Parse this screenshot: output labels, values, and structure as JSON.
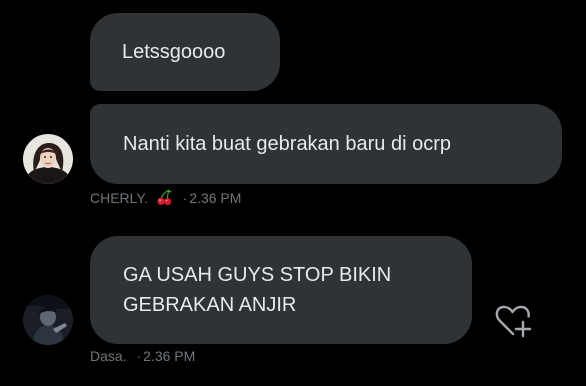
{
  "messages": [
    {
      "text": "Letssgoooo"
    },
    {
      "text": "Nanti kita buat gebrakan baru di ocrp",
      "author": "CHERLY.",
      "author_emoji": "cherry",
      "time": "2.36 PM",
      "sep": "·"
    },
    {
      "lines": [
        "GA USAH GUYS STOP BIKIN",
        "GEBRAKAN ANJIR"
      ],
      "author": "Dasa.",
      "time": "2.36 PM",
      "sep": "·"
    }
  ],
  "colors": {
    "background": "#000000",
    "bubble": "#2f3336",
    "text": "#e7e9ea",
    "meta": "#71767b"
  },
  "icons": {
    "react": "heart-plus-icon",
    "emoji": "cherry-emoji-icon"
  }
}
